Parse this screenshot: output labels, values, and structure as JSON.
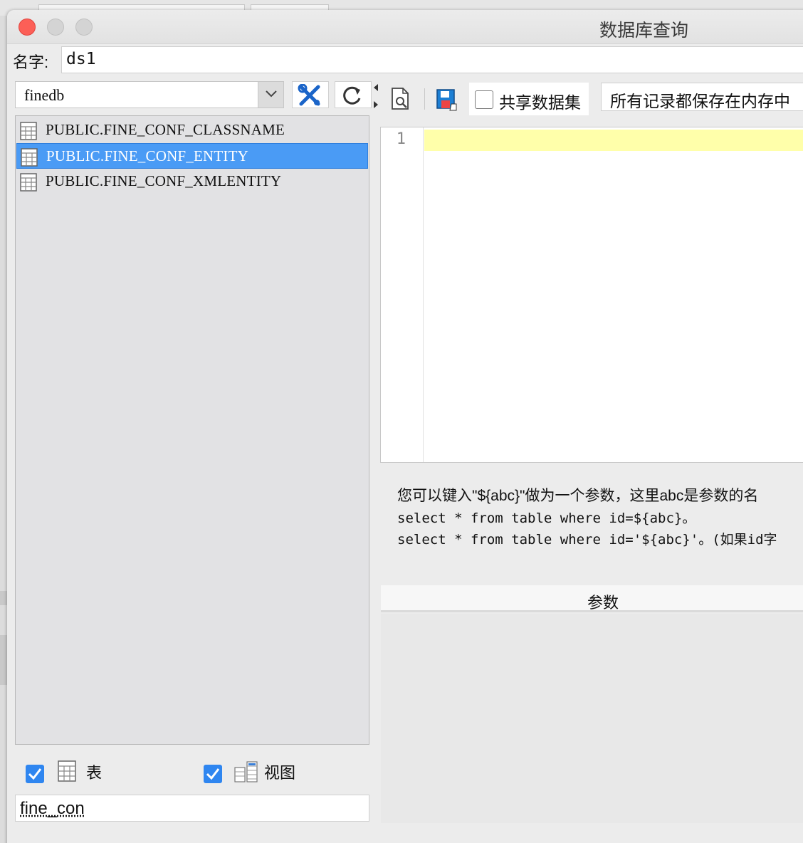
{
  "window": {
    "title": "数据库查询"
  },
  "name_field": {
    "label": "名字:",
    "value": "ds1"
  },
  "left_panel": {
    "database": "finedb",
    "tables": [
      {
        "name": "PUBLIC.FINE_CONF_CLASSNAME",
        "selected": false
      },
      {
        "name": "PUBLIC.FINE_CONF_ENTITY",
        "selected": true
      },
      {
        "name": "PUBLIC.FINE_CONF_XMLENTITY",
        "selected": false
      }
    ],
    "filters": {
      "tables_label": "表",
      "views_label": "视图"
    },
    "search_value": "fine_con"
  },
  "toolbar": {
    "share_label": "共享数据集",
    "memory_mode": "所有记录都保存在内存中"
  },
  "editor": {
    "line_numbers": [
      "1"
    ]
  },
  "hint": {
    "line1": "您可以键入\"${abc}\"做为一个参数，这里abc是参数的名",
    "line2": "select * from table where id=${abc}。",
    "line3": "select * from table where id='${abc}'。(如果id字"
  },
  "params": {
    "header": "参数"
  },
  "colors": {
    "selection": "#4a9bf5",
    "current_line": "#ffffaa",
    "checkbox": "#2f86f0",
    "close_button": "#fc5f57"
  },
  "icons": [
    "connect-wrench-icon",
    "refresh-icon",
    "preview-icon",
    "save-icon",
    "table-icon",
    "view-icon"
  ]
}
